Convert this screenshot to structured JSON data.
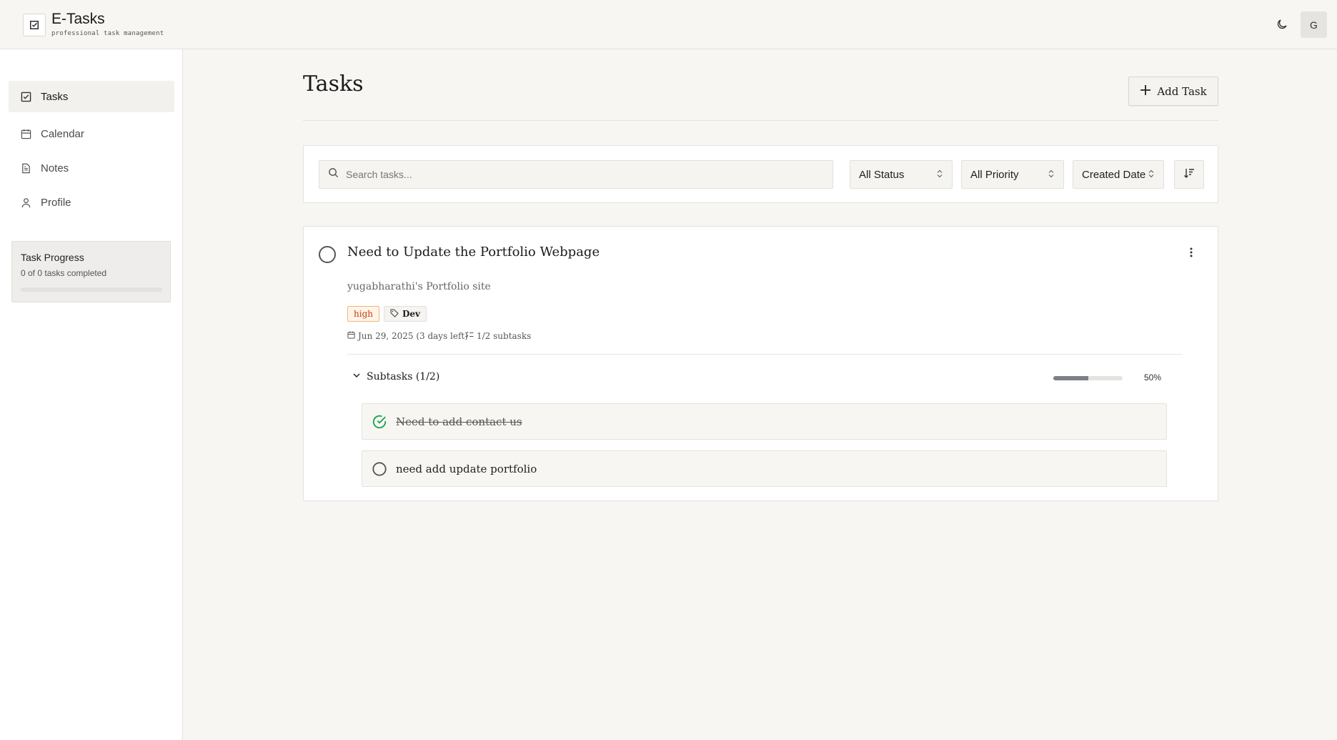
{
  "app": {
    "title": "E-Tasks",
    "subtitle": "professional task management",
    "avatar_initial": "G"
  },
  "sidebar": {
    "items": [
      {
        "label": "Tasks",
        "icon": "checkbox-icon",
        "active": true
      },
      {
        "label": "Calendar",
        "icon": "calendar-icon",
        "active": false
      },
      {
        "label": "Notes",
        "icon": "document-icon",
        "active": false
      },
      {
        "label": "Profile",
        "icon": "user-icon",
        "active": false
      }
    ],
    "progress": {
      "title": "Task Progress",
      "summary": "0 of 0 tasks completed",
      "fraction": 0
    }
  },
  "main": {
    "title": "Tasks",
    "add_label": "Add Task",
    "search_placeholder": "Search tasks...",
    "filters": {
      "status": "All Status",
      "priority": "All Priority",
      "sort": "Created Date"
    }
  },
  "task": {
    "title": "Need to Update the Portfolio Webpage",
    "description": "yugabharathi's Portfolio site",
    "priority": "high",
    "tag": "Dev",
    "due": "Jun 29, 2025 (3 days left)",
    "subtask_count": "1/2 subtasks",
    "subtasks_header": "Subtasks (1/2)",
    "subtasks_percent": "50%",
    "subtasks_fraction": 0.5,
    "subtasks": [
      {
        "text": "Need to add contact us",
        "done": true
      },
      {
        "text": "need add update portfolio",
        "done": false
      }
    ]
  },
  "colors": {
    "background": "#f7f6f3",
    "priority_high": "#c2410c",
    "done_check": "#16a34a"
  }
}
